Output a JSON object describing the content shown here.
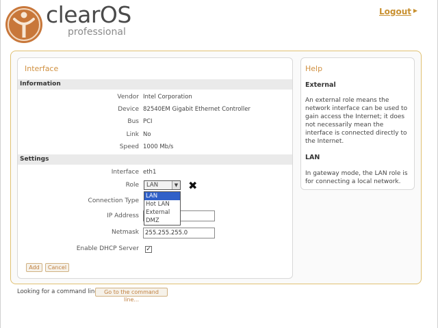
{
  "header": {
    "brand": "clearOS",
    "brand_sub": "professional",
    "logout": "Logout"
  },
  "interface_panel": {
    "title": "Interface",
    "information": {
      "heading": "Information",
      "rows": [
        {
          "label": "Vendor",
          "value": "Intel Corporation"
        },
        {
          "label": "Device",
          "value": "82540EM Gigabit Ethernet Controller"
        },
        {
          "label": "Bus",
          "value": "PCI"
        },
        {
          "label": "Link",
          "value": "No"
        },
        {
          "label": "Speed",
          "value": "1000 Mb/s"
        }
      ]
    },
    "settings": {
      "heading": "Settings",
      "interface_label": "Interface",
      "interface_value": "eth1",
      "role_label": "Role",
      "role_selected": "LAN",
      "role_options": [
        "LAN",
        "Hot LAN",
        "External",
        "DMZ"
      ],
      "connection_type_label": "Connection Type",
      "ip_address_label": "IP Address",
      "ip_address_value": "",
      "netmask_label": "Netmask",
      "netmask_value": "255.255.255.0",
      "dhcp_label": "Enable DHCP Server",
      "dhcp_checked": true
    },
    "buttons": {
      "add": "Add",
      "cancel": "Cancel"
    }
  },
  "help": {
    "title": "Help",
    "sections": [
      {
        "heading": "External",
        "text": "An external role means the network interface can be used to gain access the Internet; it does not necessarily mean the interface is connected directly to the Internet."
      },
      {
        "heading": "LAN",
        "text": "In gateway mode, the LAN role is for connecting a local network."
      }
    ]
  },
  "footer": {
    "command_line_text": "Looking for a command line?",
    "command_line_button": "Go to the command line..."
  }
}
